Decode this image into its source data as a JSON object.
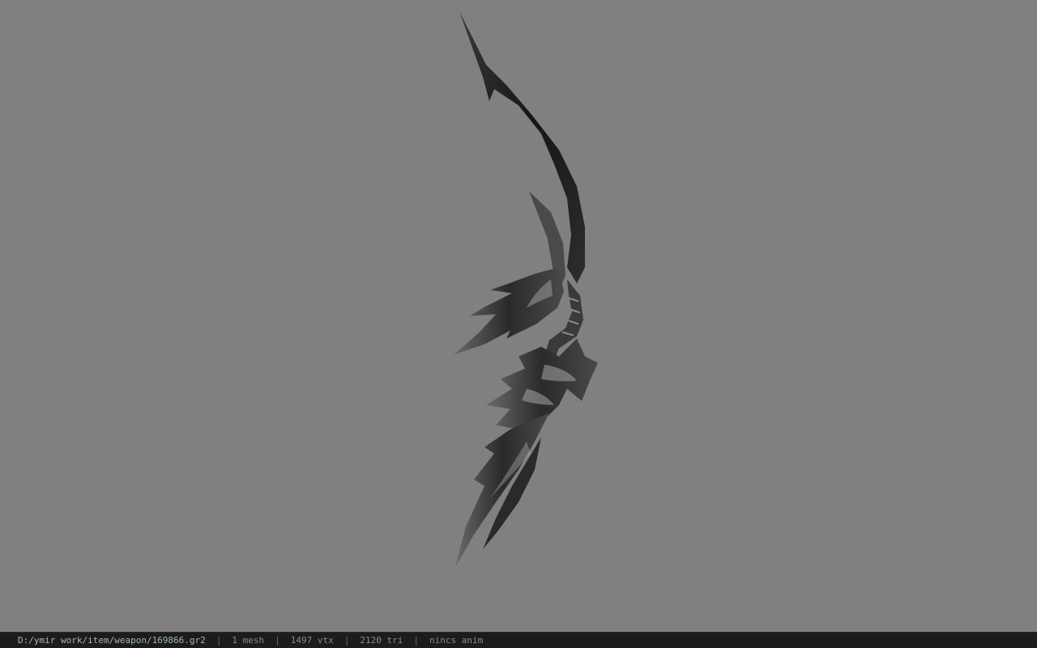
{
  "viewer": {
    "background_color": "#808080",
    "model_icon": "curved-blade-bow-model"
  },
  "status_bar": {
    "file_path": "D:/ymir work/item/weapon/169866.gr2",
    "separator": "|",
    "mesh_count": "1 mesh",
    "vertex_count": "1497 vtx",
    "triangle_count": "2120 tri",
    "animation": "nincs anim"
  }
}
